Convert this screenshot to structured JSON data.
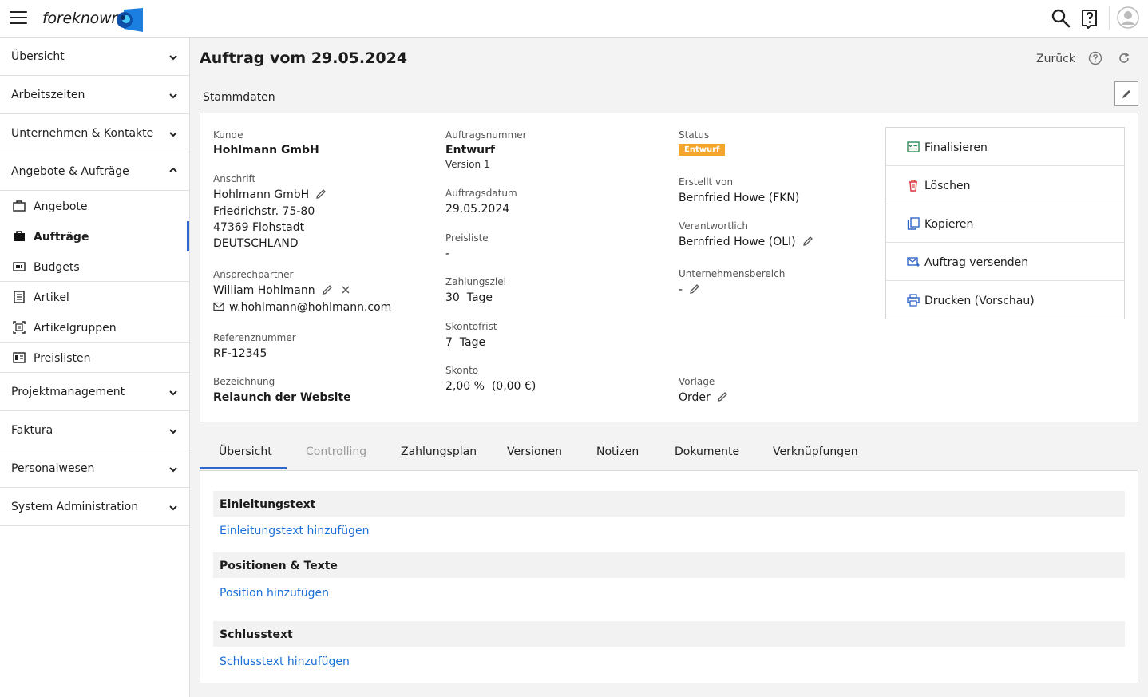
{
  "app": {
    "logo_text": "foreknown"
  },
  "sidebar": {
    "groups": [
      {
        "label": "Übersicht"
      },
      {
        "label": "Arbeitszeiten"
      },
      {
        "label": "Unternehmen & Kontakte"
      },
      {
        "label": "Angebote & Aufträge"
      },
      {
        "label": "Projektmanagement"
      },
      {
        "label": "Faktura"
      },
      {
        "label": "Personalwesen"
      },
      {
        "label": "System Administration"
      }
    ],
    "subitems": [
      {
        "label": "Angebote",
        "icon": "briefcase-outline-icon"
      },
      {
        "label": "Aufträge",
        "icon": "briefcase-filled-icon",
        "active": true
      },
      {
        "label": "Budgets",
        "icon": "budget-icon"
      },
      {
        "label": "Artikel",
        "icon": "document-icon"
      },
      {
        "label": "Artikelgruppen",
        "icon": "group-icon"
      },
      {
        "label": "Preislisten",
        "icon": "pricelist-icon"
      }
    ]
  },
  "header": {
    "title": "Auftrag vom 29.05.2024",
    "back_label": "Zurück"
  },
  "stammdaten": {
    "section_label": "Stammdaten",
    "kunde": {
      "label": "Kunde",
      "value": "Hohlmann GmbH"
    },
    "anschrift": {
      "label": "Anschrift",
      "name": "Hohlmann GmbH",
      "street": "Friedrichstr. 75-80",
      "city": "47369 Flohstadt",
      "country": "DEUTSCHLAND"
    },
    "ansprechpartner": {
      "label": "Ansprechpartner",
      "name": "William Hohlmann",
      "email": "w.hohlmann@hohlmann.com"
    },
    "referenznummer": {
      "label": "Referenznummer",
      "value": "RF-12345"
    },
    "bezeichnung": {
      "label": "Bezeichnung",
      "value": "Relaunch der Website"
    },
    "auftragsnummer": {
      "label": "Auftragsnummer",
      "value": "Entwurf",
      "version": "Version 1"
    },
    "auftragsdatum": {
      "label": "Auftragsdatum",
      "value": "29.05.2024"
    },
    "preisliste": {
      "label": "Preisliste",
      "value": "-"
    },
    "zahlungsziel": {
      "label": "Zahlungsziel",
      "value": "30  Tage"
    },
    "skontofrist": {
      "label": "Skontofrist",
      "value": "7  Tage"
    },
    "skonto": {
      "label": "Skonto",
      "value": "2,00 %  (0,00 €)"
    },
    "status": {
      "label": "Status",
      "value": "Entwurf",
      "color": "#f4a62a"
    },
    "erstellt_von": {
      "label": "Erstellt von",
      "value": "Bernfried Howe (FKN)"
    },
    "verantwortlich": {
      "label": "Verantwortlich",
      "value": "Bernfried Howe (OLI)"
    },
    "unternehmensbereich": {
      "label": "Unternehmensbereich",
      "value": "-"
    },
    "vorlage": {
      "label": "Vorlage",
      "value": "Order"
    }
  },
  "actions": [
    {
      "label": "Finalisieren",
      "icon": "finalize-icon",
      "color": "#2e8b57"
    },
    {
      "label": "Löschen",
      "icon": "trash-icon",
      "color": "#d9363e"
    },
    {
      "label": "Kopieren",
      "icon": "copy-icon",
      "color": "#2f66c9"
    },
    {
      "label": "Auftrag versenden",
      "icon": "send-mail-icon",
      "color": "#2f66c9"
    },
    {
      "label": "Drucken (Vorschau)",
      "icon": "printer-icon",
      "color": "#2f66c9"
    }
  ],
  "tabs": [
    {
      "label": "Übersicht",
      "active": true
    },
    {
      "label": "Controlling",
      "disabled": true
    },
    {
      "label": "Zahlungsplan"
    },
    {
      "label": "Versionen"
    },
    {
      "label": "Notizen"
    },
    {
      "label": "Dokumente"
    },
    {
      "label": "Verknüpfungen"
    }
  ],
  "overview": {
    "einleitung": {
      "title": "Einleitungstext",
      "link": "Einleitungstext hinzufügen"
    },
    "positionen": {
      "title": "Positionen & Texte",
      "link": "Position hinzufügen"
    },
    "schluss": {
      "title": "Schlusstext",
      "link": "Schlusstext hinzufügen"
    }
  }
}
